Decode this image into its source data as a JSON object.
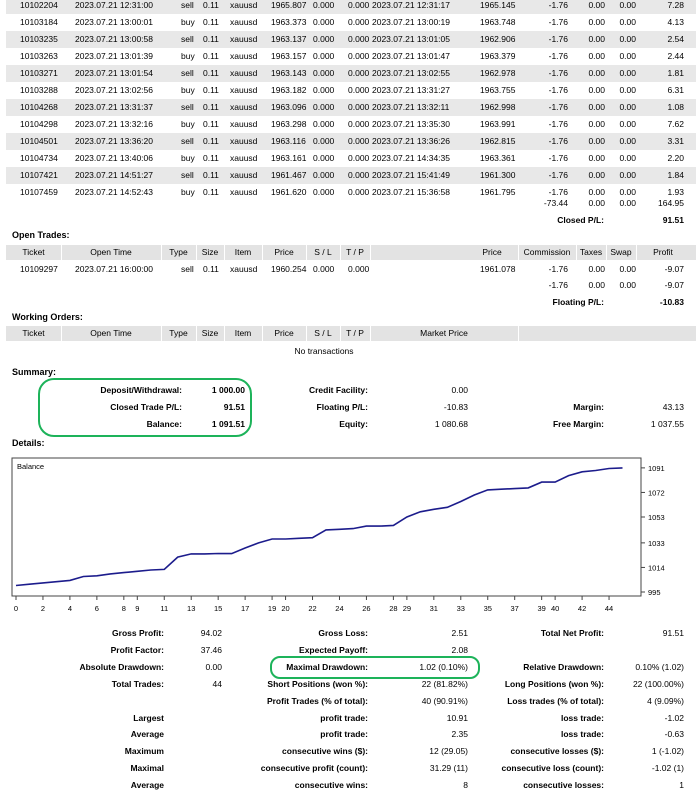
{
  "closed_trades": [
    {
      "ticket": "10102204",
      "open_time": "2023.07.21 12:31:00",
      "type": "sell",
      "size": "0.11",
      "item": "xauusd",
      "price": "1965.807",
      "sl": "0.000",
      "tp": "0.000",
      "close_time": "2023.07.21 12:31:17",
      "close_price": "1965.145",
      "commission": "-1.76",
      "taxes": "0.00",
      "swap": "0.00",
      "profit": "7.28"
    },
    {
      "ticket": "10103184",
      "open_time": "2023.07.21 13:00:01",
      "type": "buy",
      "size": "0.11",
      "item": "xauusd",
      "price": "1963.373",
      "sl": "0.000",
      "tp": "0.000",
      "close_time": "2023.07.21 13:00:19",
      "close_price": "1963.748",
      "commission": "-1.76",
      "taxes": "0.00",
      "swap": "0.00",
      "profit": "4.13"
    },
    {
      "ticket": "10103235",
      "open_time": "2023.07.21 13:00:58",
      "type": "sell",
      "size": "0.11",
      "item": "xauusd",
      "price": "1963.137",
      "sl": "0.000",
      "tp": "0.000",
      "close_time": "2023.07.21 13:01:05",
      "close_price": "1962.906",
      "commission": "-1.76",
      "taxes": "0.00",
      "swap": "0.00",
      "profit": "2.54"
    },
    {
      "ticket": "10103263",
      "open_time": "2023.07.21 13:01:39",
      "type": "buy",
      "size": "0.11",
      "item": "xauusd",
      "price": "1963.157",
      "sl": "0.000",
      "tp": "0.000",
      "close_time": "2023.07.21 13:01:47",
      "close_price": "1963.379",
      "commission": "-1.76",
      "taxes": "0.00",
      "swap": "0.00",
      "profit": "2.44"
    },
    {
      "ticket": "10103271",
      "open_time": "2023.07.21 13:01:54",
      "type": "sell",
      "size": "0.11",
      "item": "xauusd",
      "price": "1963.143",
      "sl": "0.000",
      "tp": "0.000",
      "close_time": "2023.07.21 13:02:55",
      "close_price": "1962.978",
      "commission": "-1.76",
      "taxes": "0.00",
      "swap": "0.00",
      "profit": "1.81"
    },
    {
      "ticket": "10103288",
      "open_time": "2023.07.21 13:02:56",
      "type": "buy",
      "size": "0.11",
      "item": "xauusd",
      "price": "1963.182",
      "sl": "0.000",
      "tp": "0.000",
      "close_time": "2023.07.21 13:31:27",
      "close_price": "1963.755",
      "commission": "-1.76",
      "taxes": "0.00",
      "swap": "0.00",
      "profit": "6.31"
    },
    {
      "ticket": "10104268",
      "open_time": "2023.07.21 13:31:37",
      "type": "sell",
      "size": "0.11",
      "item": "xauusd",
      "price": "1963.096",
      "sl": "0.000",
      "tp": "0.000",
      "close_time": "2023.07.21 13:32:11",
      "close_price": "1962.998",
      "commission": "-1.76",
      "taxes": "0.00",
      "swap": "0.00",
      "profit": "1.08"
    },
    {
      "ticket": "10104298",
      "open_time": "2023.07.21 13:32:16",
      "type": "buy",
      "size": "0.11",
      "item": "xauusd",
      "price": "1963.298",
      "sl": "0.000",
      "tp": "0.000",
      "close_time": "2023.07.21 13:35:30",
      "close_price": "1963.991",
      "commission": "-1.76",
      "taxes": "0.00",
      "swap": "0.00",
      "profit": "7.62"
    },
    {
      "ticket": "10104501",
      "open_time": "2023.07.21 13:36:20",
      "type": "sell",
      "size": "0.11",
      "item": "xauusd",
      "price": "1963.116",
      "sl": "0.000",
      "tp": "0.000",
      "close_time": "2023.07.21 13:36:26",
      "close_price": "1962.815",
      "commission": "-1.76",
      "taxes": "0.00",
      "swap": "0.00",
      "profit": "3.31"
    },
    {
      "ticket": "10104734",
      "open_time": "2023.07.21 13:40:06",
      "type": "buy",
      "size": "0.11",
      "item": "xauusd",
      "price": "1963.161",
      "sl": "0.000",
      "tp": "0.000",
      "close_time": "2023.07.21 14:34:35",
      "close_price": "1963.361",
      "commission": "-1.76",
      "taxes": "0.00",
      "swap": "0.00",
      "profit": "2.20"
    },
    {
      "ticket": "10107421",
      "open_time": "2023.07.21 14:51:27",
      "type": "sell",
      "size": "0.11",
      "item": "xauusd",
      "price": "1961.467",
      "sl": "0.000",
      "tp": "0.000",
      "close_time": "2023.07.21 15:41:49",
      "close_price": "1961.300",
      "commission": "-1.76",
      "taxes": "0.00",
      "swap": "0.00",
      "profit": "1.84"
    },
    {
      "ticket": "10107459",
      "open_time": "2023.07.21 14:52:43",
      "type": "buy",
      "size": "0.11",
      "item": "xauusd",
      "price": "1961.620",
      "sl": "0.000",
      "tp": "0.000",
      "close_time": "2023.07.21 15:36:58",
      "close_price": "1961.795",
      "commission": "-1.76",
      "taxes": "0.00",
      "swap": "0.00",
      "profit": "1.93"
    }
  ],
  "closed_totals": {
    "commission": "-73.44",
    "taxes": "0.00",
    "swap": "0.00",
    "profit": "164.95",
    "pl_label": "Closed P/L:",
    "pl_value": "91.51"
  },
  "open_trades": {
    "title": "Open Trades:",
    "headers": {
      "ticket": "Ticket",
      "open_time": "Open Time",
      "type": "Type",
      "size": "Size",
      "item": "Item",
      "price": "Price",
      "sl": "S / L",
      "tp": "T / P",
      "market_price": "Price",
      "commission": "Commission",
      "taxes": "Taxes",
      "swap": "Swap",
      "profit": "Profit"
    },
    "row": {
      "ticket": "10109297",
      "open_time": "2023.07.21 16:00:00",
      "type": "sell",
      "size": "0.11",
      "item": "xauusd",
      "price": "1960.254",
      "sl": "0.000",
      "tp": "0.000",
      "market_price": "1961.078",
      "commission": "-1.76",
      "taxes": "0.00",
      "swap": "0.00",
      "profit": "-9.07"
    },
    "totals": {
      "commission": "-1.76",
      "taxes": "0.00",
      "swap": "0.00",
      "profit": "-9.07"
    },
    "floating_label": "Floating P/L:",
    "floating_value": "-10.83"
  },
  "working_orders": {
    "title": "Working Orders:",
    "headers": {
      "ticket": "Ticket",
      "open_time": "Open Time",
      "type": "Type",
      "size": "Size",
      "item": "Item",
      "price": "Price",
      "sl": "S / L",
      "tp": "T / P",
      "market_price": "Market Price"
    },
    "empty": "No transactions"
  },
  "summary": {
    "title": "Summary:",
    "deposit_label": "Deposit/Withdrawal:",
    "deposit_value": "1 000.00",
    "closed_label": "Closed Trade P/L:",
    "closed_value": "91.51",
    "balance_label": "Balance:",
    "balance_value": "1 091.51",
    "credit_label": "Credit Facility:",
    "credit_value": "0.00",
    "floating_label": "Floating P/L:",
    "floating_value": "-10.83",
    "equity_label": "Equity:",
    "equity_value": "1 080.68",
    "margin_label": "Margin:",
    "margin_value": "43.13",
    "free_margin_label": "Free Margin:",
    "free_margin_value": "1 037.55"
  },
  "details_title": "Details:",
  "chart_data": {
    "type": "line",
    "legend": "Balance",
    "x_ticks": [
      "0",
      "2",
      "4",
      "6",
      "8",
      "9",
      "11",
      "13",
      "15",
      "17",
      "19",
      "20",
      "22",
      "24",
      "26",
      "28",
      "29",
      "31",
      "33",
      "35",
      "37",
      "39",
      "40",
      "42",
      "44"
    ],
    "y_ticks": [
      "1091",
      "1072",
      "1053",
      "1033",
      "1014",
      "995"
    ],
    "ylim": [
      995,
      1094
    ],
    "xlim": [
      0,
      46
    ],
    "x": [
      0,
      1,
      2,
      3,
      4,
      5,
      6,
      7,
      8,
      9,
      10,
      11,
      12,
      13,
      14,
      15,
      16,
      17,
      18,
      19,
      20,
      21,
      22,
      23,
      24,
      25,
      26,
      27,
      28,
      29,
      30,
      31,
      32,
      33,
      34,
      35,
      36,
      37,
      38,
      39,
      40,
      41,
      42,
      43,
      44,
      45
    ],
    "values": [
      1000.0,
      1001.0,
      1002.0,
      1003.0,
      1004.0,
      1007.0,
      1007.5,
      1009.0,
      1010.0,
      1011.0,
      1012.0,
      1012.5,
      1022.0,
      1024.5,
      1024.5,
      1024.8,
      1024.7,
      1029.0,
      1033.0,
      1036.0,
      1036.0,
      1036.5,
      1037.0,
      1043.0,
      1043.5,
      1044.0,
      1046.0,
      1046.0,
      1046.5,
      1053.0,
      1057.0,
      1059.0,
      1060.5,
      1065.0,
      1070.0,
      1074.0,
      1074.5,
      1075.0,
      1075.5,
      1080.0,
      1080.0,
      1085.0,
      1088.0,
      1089.0,
      1090.5,
      1091.0
    ],
    "color": "#1c1c8c"
  },
  "details": {
    "rows": [
      {
        "l1": "Gross Profit:",
        "v1": "94.02",
        "l2": "Gross Loss:",
        "v2": "2.51",
        "l3": "Total Net Profit:",
        "v3": "91.51"
      },
      {
        "l1": "Profit Factor:",
        "v1": "37.46",
        "l2": "Expected Payoff:",
        "v2": "2.08",
        "l3": "",
        "v3": ""
      },
      {
        "l1": "Absolute Drawdown:",
        "v1": "0.00",
        "l2": "Maximal Drawdown:",
        "v2": "1.02 (0.10%)",
        "l3": "Relative Drawdown:",
        "v3": "0.10% (1.02)"
      },
      {
        "l1": "Total Trades:",
        "v1": "44",
        "l2": "Short Positions (won %):",
        "v2": "22 (81.82%)",
        "l3": "Long Positions (won %):",
        "v3": "22 (100.00%)"
      },
      {
        "l1": "",
        "v1": "",
        "l2": "Profit Trades (% of total):",
        "v2": "40 (90.91%)",
        "l3": "Loss trades (% of total):",
        "v3": "4 (9.09%)"
      },
      {
        "l1": "Largest",
        "v1": "",
        "l2": "profit trade:",
        "v2": "10.91",
        "l3": "loss trade:",
        "v3": "-1.02"
      },
      {
        "l1": "Average",
        "v1": "",
        "l2": "profit trade:",
        "v2": "2.35",
        "l3": "loss trade:",
        "v3": "-0.63"
      },
      {
        "l1": "Maximum",
        "v1": "",
        "l2": "consecutive wins ($):",
        "v2": "12 (29.05)",
        "l3": "consecutive losses ($):",
        "v3": "1 (-1.02)"
      },
      {
        "l1": "Maximal",
        "v1": "",
        "l2": "consecutive profit (count):",
        "v2": "31.29 (11)",
        "l3": "consecutive loss (count):",
        "v3": "-1.02 (1)"
      },
      {
        "l1": "Average",
        "v1": "",
        "l2": "consecutive wins:",
        "v2": "8",
        "l3": "consecutive losses:",
        "v3": "1"
      }
    ]
  },
  "colors": {
    "row_alt": "#e8e8e8",
    "header": "#e3e3e3",
    "highlight": "#1db35a",
    "balance_line": "#1c1c8c"
  }
}
